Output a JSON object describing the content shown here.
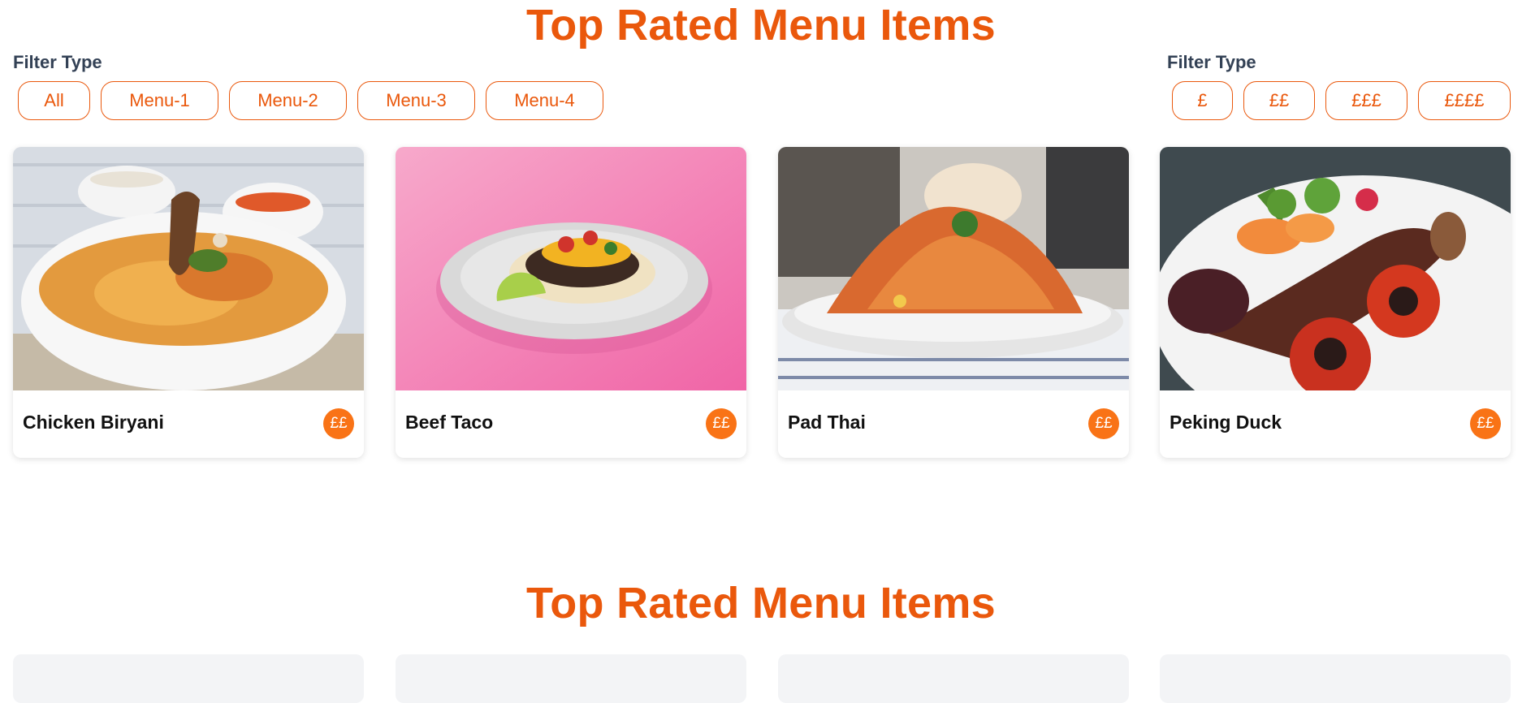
{
  "section_title": "Top Rated Menu Items",
  "section_title_2": "Top Rated Menu Items",
  "filters_left": {
    "label": "Filter Type",
    "options": [
      "All",
      "Menu-1",
      "Menu-2",
      "Menu-3",
      "Menu-4"
    ]
  },
  "filters_right": {
    "label": "Filter Type",
    "options": [
      "£",
      "££",
      "£££",
      "££££"
    ]
  },
  "cards": [
    {
      "name": "Chicken Biryani",
      "price": "££"
    },
    {
      "name": "Beef Taco",
      "price": "££"
    },
    {
      "name": "Pad Thai",
      "price": "££"
    },
    {
      "name": "Peking Duck",
      "price": "££"
    }
  ],
  "colors": {
    "accent": "#ea580c",
    "badge": "#f97316"
  }
}
